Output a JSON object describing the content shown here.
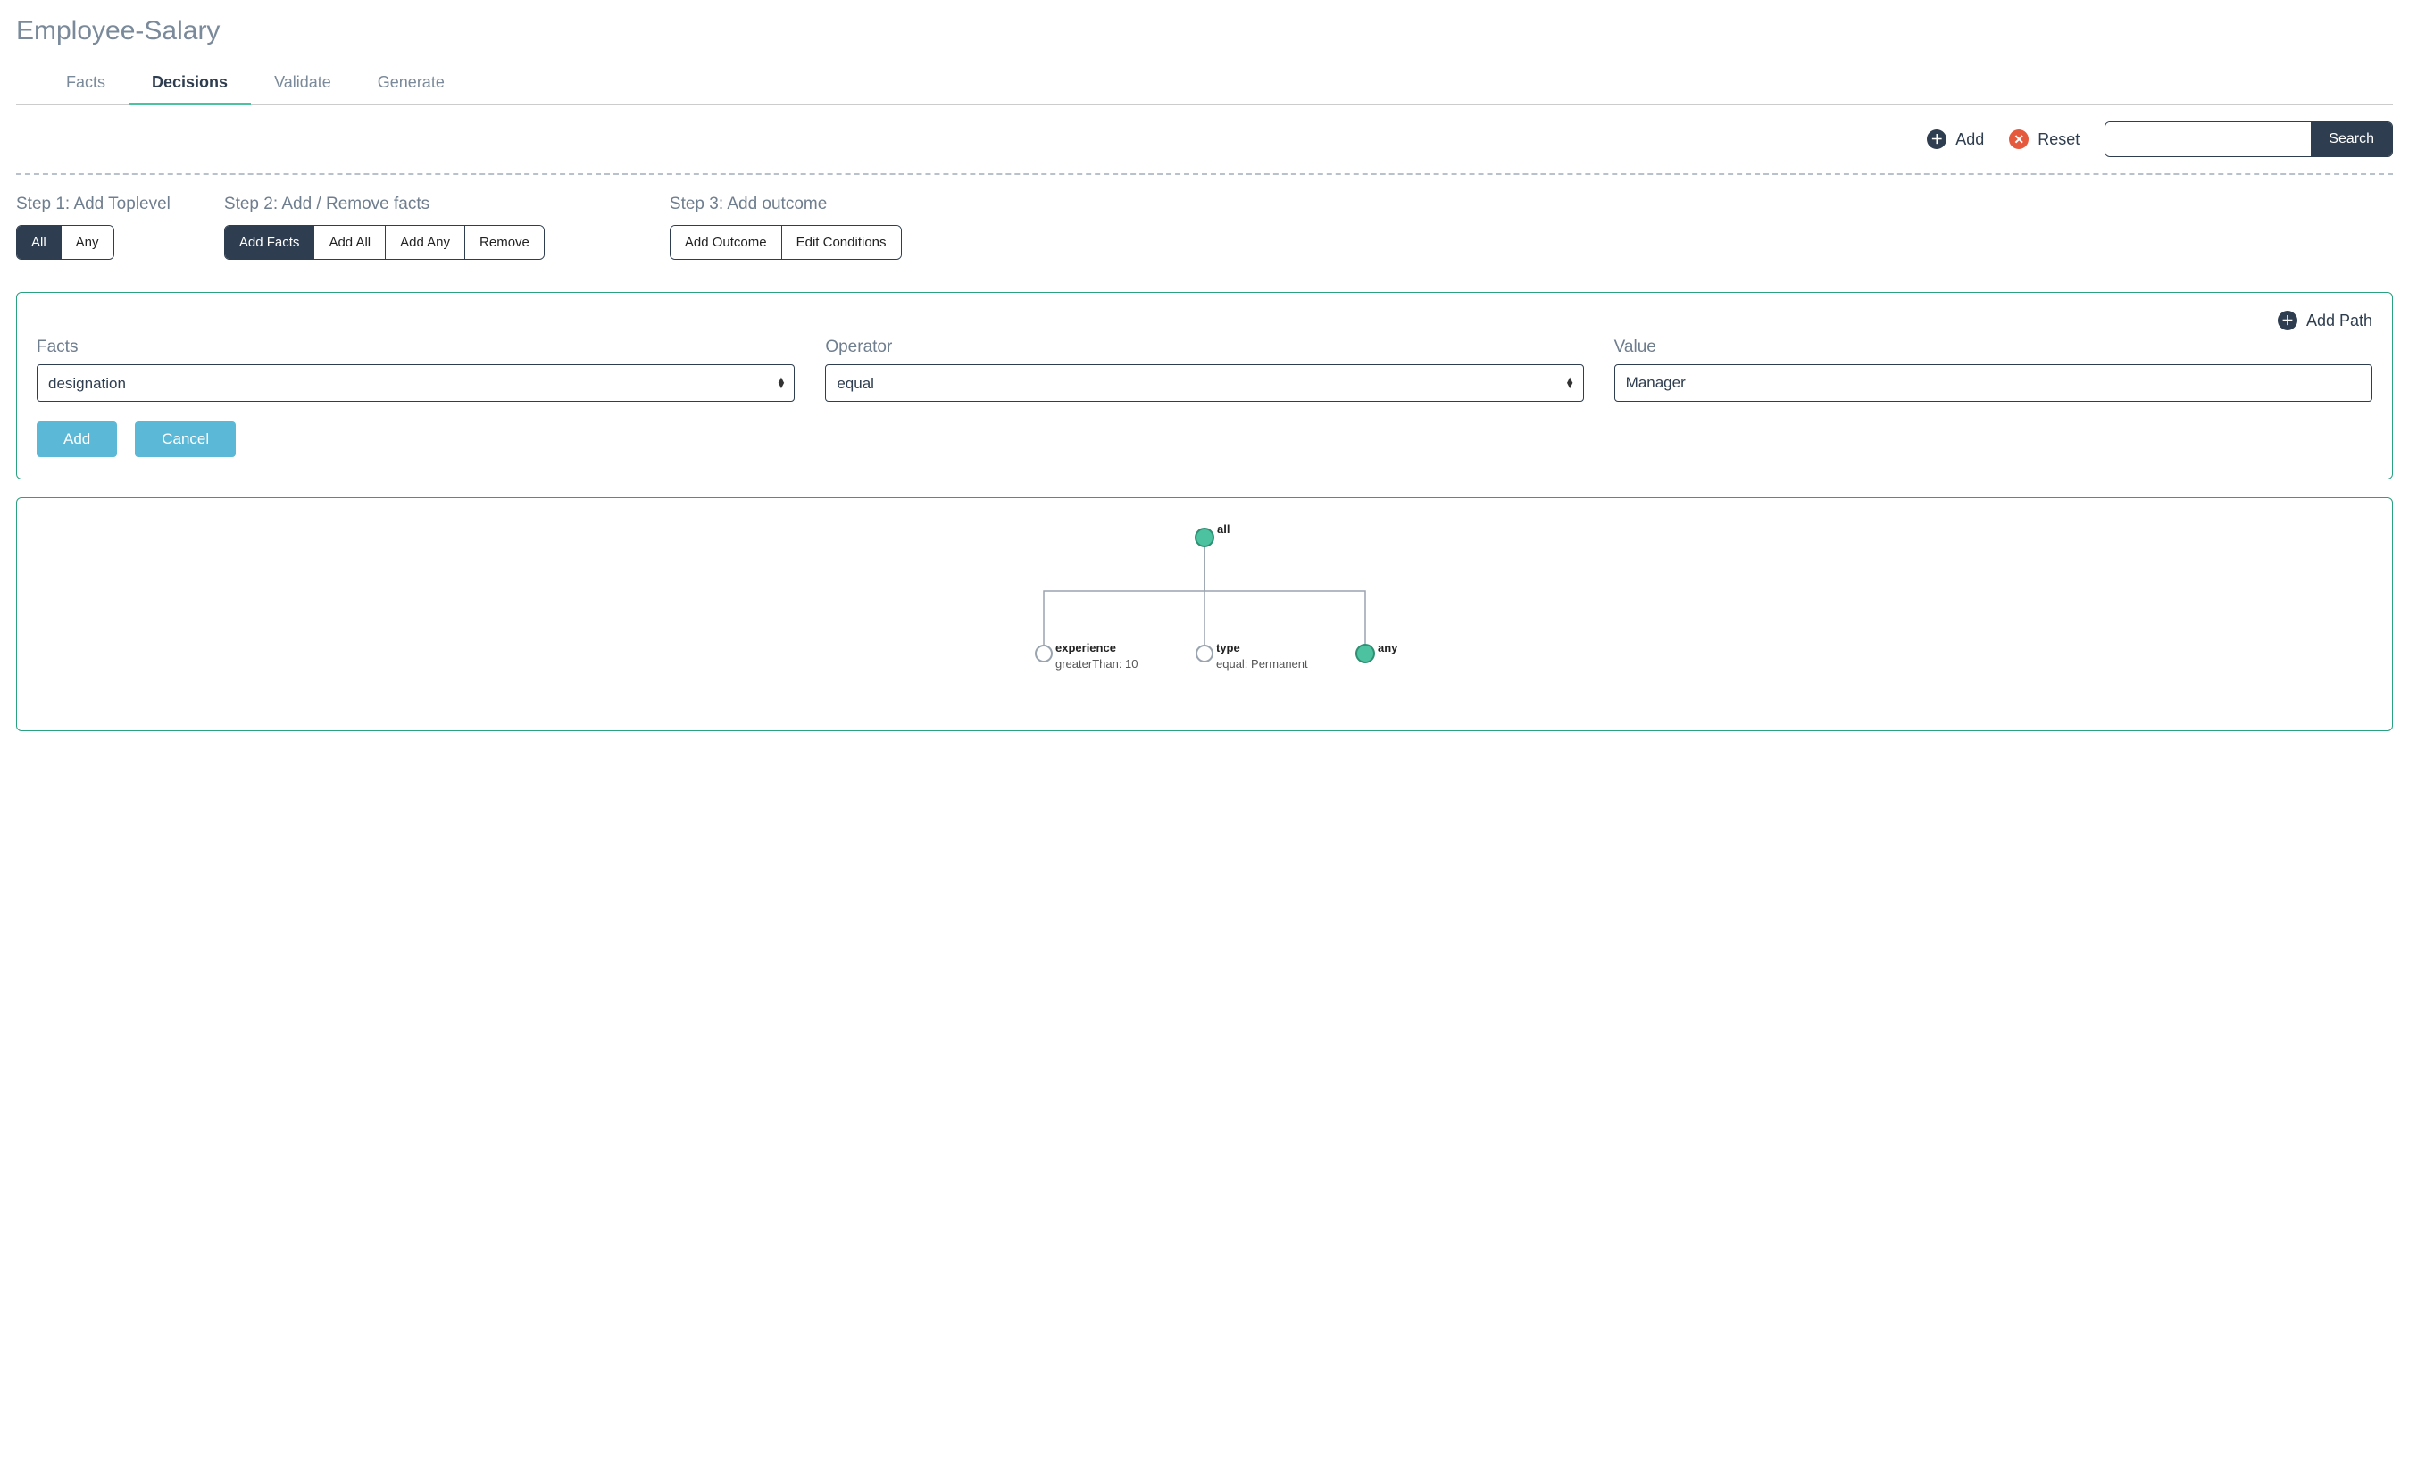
{
  "pageTitle": "Employee-Salary",
  "tabs": [
    {
      "label": "Facts"
    },
    {
      "label": "Decisions"
    },
    {
      "label": "Validate"
    },
    {
      "label": "Generate"
    }
  ],
  "activeTabIndex": 1,
  "toolbar": {
    "addLabel": "Add",
    "resetLabel": "Reset",
    "searchButton": "Search",
    "searchValue": ""
  },
  "steps": {
    "step1": {
      "title": "Step 1: Add Toplevel",
      "buttons": [
        "All",
        "Any"
      ],
      "selectedIndex": 0
    },
    "step2": {
      "title": "Step 2: Add / Remove facts",
      "buttons": [
        "Add Facts",
        "Add All",
        "Add Any",
        "Remove"
      ],
      "selectedIndex": 0
    },
    "step3": {
      "title": "Step 3: Add outcome",
      "buttons": [
        "Add Outcome",
        "Edit Conditions"
      ],
      "selectedIndex": -1
    }
  },
  "addPanel": {
    "addPathLabel": "Add Path",
    "factsLabel": "Facts",
    "operatorLabel": "Operator",
    "valueLabel": "Value",
    "factsValue": "designation",
    "operatorValue": "equal",
    "valueValue": "Manager",
    "addButton": "Add",
    "cancelButton": "Cancel"
  },
  "tree": {
    "root": {
      "label": "all",
      "filled": true
    },
    "children": [
      {
        "fact": "experience",
        "detail": "greaterThan: 10",
        "filled": false
      },
      {
        "fact": "type",
        "detail": "equal: Permanent",
        "filled": false
      },
      {
        "fact": "any",
        "detail": "",
        "filled": true
      }
    ]
  }
}
